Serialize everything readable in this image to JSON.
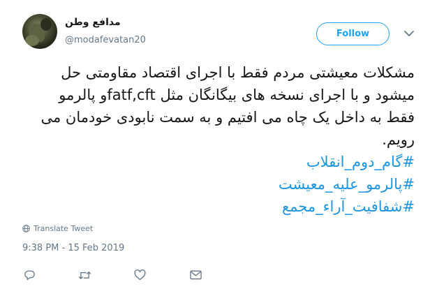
{
  "author": {
    "display_name": "مدافع وطن",
    "handle": "@modafevatan20"
  },
  "header": {
    "follow_label": "Follow",
    "menu_icon": "chevron-down-icon"
  },
  "tweet": {
    "lines": [
      "مشکلات معیشتی مردم فقط با اجرای اقتصاد مقاومتی حل",
      "میشود و با اجرای نسخه های بیگانگان مثل  fatf,cftو پالرمو",
      "فقط به داخل یک چاه می افتیم و به سمت نابودی خودمان می",
      "رویم."
    ],
    "hashtags": [
      "#گام_دوم_انقلاب",
      "#پالرمو_علیه_معیشت",
      "#شفافیت_آراء_مجمع"
    ]
  },
  "translate_label": "Translate Tweet",
  "timestamp": "9:38 PM - 15 Feb 2019",
  "actions": [
    "reply-icon",
    "retweet-icon",
    "like-icon",
    "message-icon"
  ],
  "colors": {
    "accent": "#1da1f2",
    "hashtag": "#1b95e0",
    "muted": "#657786",
    "text": "#14171a"
  }
}
